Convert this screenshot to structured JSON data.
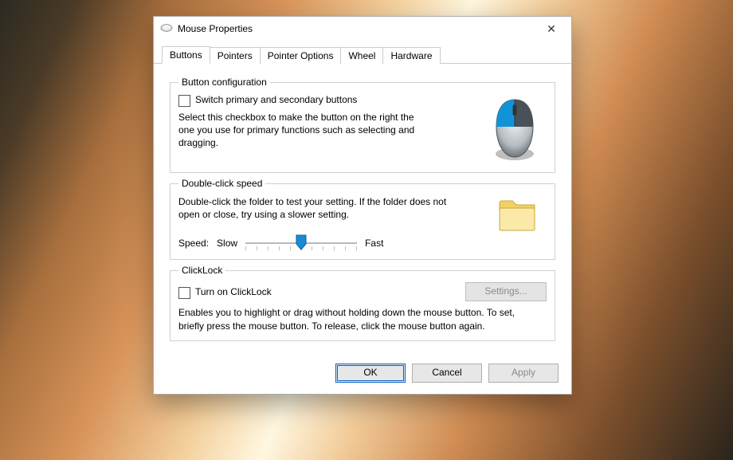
{
  "window": {
    "title": "Mouse Properties",
    "close_glyph": "✕"
  },
  "tabs": [
    "Buttons",
    "Pointers",
    "Pointer Options",
    "Wheel",
    "Hardware"
  ],
  "active_tab": "Buttons",
  "button_config": {
    "legend": "Button configuration",
    "checkbox_label": "Switch primary and secondary buttons",
    "checked": false,
    "description": "Select this checkbox to make the button on the right the one you use for primary functions such as selecting and dragging."
  },
  "double_click": {
    "legend": "Double-click speed",
    "description": "Double-click the folder to test your setting. If the folder does not open or close, try using a slower setting.",
    "speed_label": "Speed:",
    "slow_label": "Slow",
    "fast_label": "Fast",
    "slider_pos_pct": 50
  },
  "clicklock": {
    "legend": "ClickLock",
    "checkbox_label": "Turn on ClickLock",
    "checked": false,
    "settings_label": "Settings...",
    "settings_enabled": false,
    "description": "Enables you to highlight or drag without holding down the mouse button. To set, briefly press the mouse button. To release, click the mouse button again."
  },
  "buttons": {
    "ok": "OK",
    "cancel": "Cancel",
    "apply": "Apply",
    "apply_enabled": false
  }
}
